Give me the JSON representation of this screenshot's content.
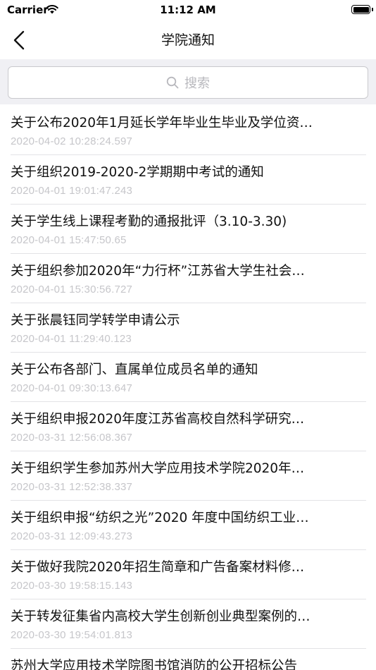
{
  "status_bar": {
    "carrier": "Carrier",
    "time": "11:12 AM"
  },
  "nav": {
    "title": "学院通知",
    "back_icon": "chevron-left-icon"
  },
  "search": {
    "placeholder": "搜索",
    "icon": "search-icon"
  },
  "colors": {
    "search_bg": "#f0f0f4",
    "date_text": "#c6c6ca",
    "divider": "#e3e3e6"
  },
  "notices": [
    {
      "title": "关于公布2020年1月延长学年毕业生毕业及学位资…",
      "date": "2020-04-02 10:28:24.597"
    },
    {
      "title": "关于组织2019-2020-2学期期中考试的通知",
      "date": "2020-04-01 19:01:47.243"
    },
    {
      "title": "关于学生线上课程考勤的通报批评（3.10-3.30)",
      "date": "2020-04-01 15:47:50.65"
    },
    {
      "title": "关于组织参加2020年“力行杯”江苏省大学生社会…",
      "date": "2020-04-01 15:30:56.727"
    },
    {
      "title": "关于张晨钰同学转学申请公示",
      "date": "2020-04-01 11:29:40.123"
    },
    {
      "title": "关于公布各部门、直属单位成员名单的通知",
      "date": "2020-04-01 09:30:13.647"
    },
    {
      "title": "关于组织申报2020年度江苏省高校自然科学研究…",
      "date": "2020-03-31 12:56:08.367"
    },
    {
      "title": "关于组织学生参加苏州大学应用技术学院2020年…",
      "date": "2020-03-31 12:52:38.337"
    },
    {
      "title": "关于组织申报“纺织之光”2020 年度中国纺织工业…",
      "date": "2020-03-31 12:09:43.273"
    },
    {
      "title": "关于做好我院2020年招生简章和广告备案材料修…",
      "date": "2020-03-30 19:58:15.143"
    },
    {
      "title": "关于转发征集省内高校大学生创新创业典型案例的…",
      "date": "2020-03-30 19:54:01.813"
    },
    {
      "title": "苏州大学应用技术学院图书馆消防的公开招标公告",
      "date": ""
    }
  ]
}
